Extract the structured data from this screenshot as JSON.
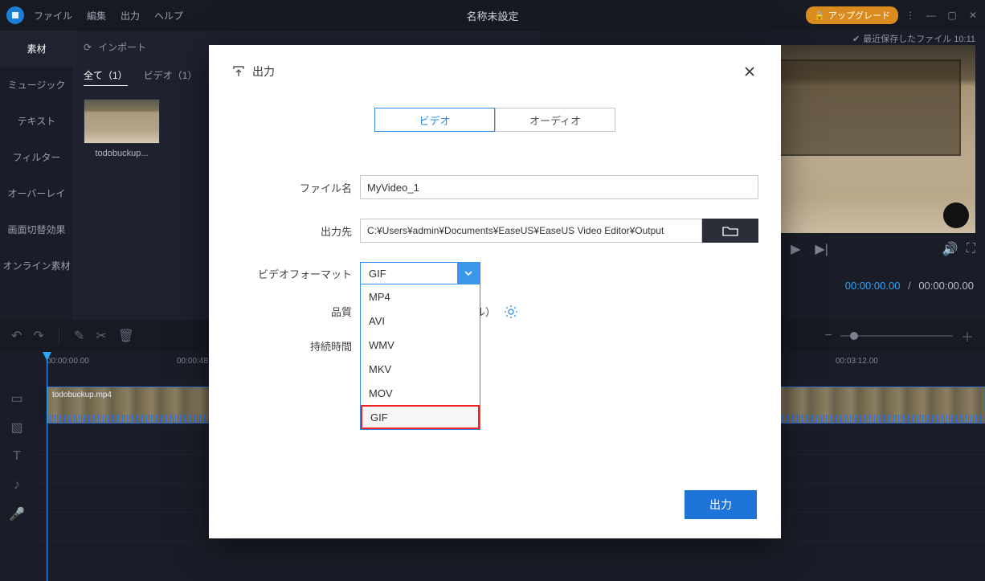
{
  "top": {
    "menus": [
      "ファイル",
      "編集",
      "出力",
      "ヘルプ"
    ],
    "title": "名称未設定",
    "upgrade": "アップグレード",
    "last_saved": "最近保存したファイル 10:11"
  },
  "sidebar": {
    "items": [
      "素材",
      "ミュージック",
      "テキスト",
      "フィルター",
      "オーバーレイ",
      "画面切替効果",
      "オンライン素材"
    ]
  },
  "media": {
    "import": "インポート",
    "tabs": [
      {
        "label": "全て（1）",
        "active": true
      },
      {
        "label": "ビデオ（1）",
        "active": false
      }
    ],
    "thumb_label": "todobuckup..."
  },
  "preview": {
    "current": "00:00:00.00",
    "total": "00:00:00.00"
  },
  "timeline": {
    "ticks": [
      "00:00:00.00",
      "00:00:48.00",
      "00:03:12.00"
    ],
    "clip_label": "todobuckup.mp4"
  },
  "modal": {
    "title": "出力",
    "tabs": {
      "video": "ビデオ",
      "audio": "オーディオ"
    },
    "filename_label": "ファイル名",
    "filename_value": "MyVideo_1",
    "outpath_label": "出力先",
    "outpath_value": "C:¥Users¥admin¥Documents¥EaseUS¥EaseUS Video Editor¥Output",
    "format_label": "ビデオフォーマット",
    "format_selected": "GIF",
    "format_options": [
      "MP4",
      "AVI",
      "WMV",
      "MKV",
      "MOV",
      "GIF"
    ],
    "quality_label": "品質",
    "quality_value": "標準（小さいファイル）",
    "duration_label": "持続時間",
    "export_button": "出力"
  }
}
